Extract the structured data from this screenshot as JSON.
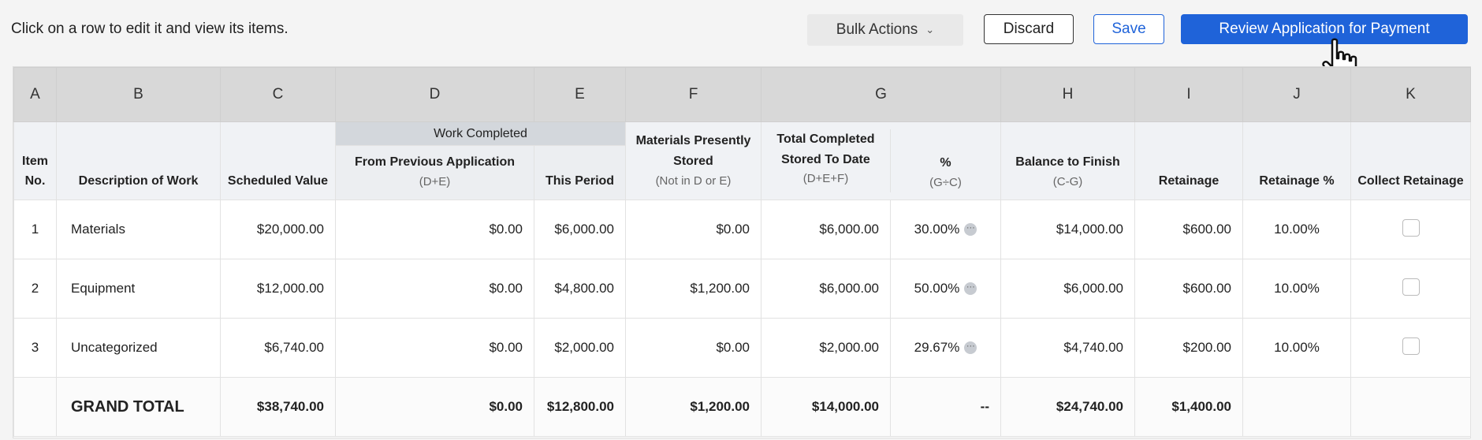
{
  "toolbar": {
    "instructions": "Click on a row to edit it and view its items.",
    "bulk_actions": "Bulk Actions",
    "discard": "Discard",
    "save": "Save",
    "review": "Review Application for Payment"
  },
  "columns": {
    "letters": [
      "A",
      "B",
      "C",
      "D",
      "E",
      "F",
      "G",
      "H",
      "I",
      "J",
      "K"
    ],
    "group_label": "Work Completed",
    "item_no": "Item No.",
    "description": "Description of Work",
    "scheduled": "Scheduled Value",
    "from_prev": "From Previous Application",
    "from_prev_sub": "(D+E)",
    "this_period": "This Period",
    "materials": "Materials Presently Stored",
    "materials_sub": "(Not in D or E)",
    "total_completed": "Total Completed Stored To Date",
    "total_completed_sub": "(D+E+F)",
    "pct": "%",
    "pct_sub": "(G÷C)",
    "balance": "Balance to Finish",
    "balance_sub": "(C-G)",
    "retainage": "Retainage",
    "retainage_pct": "Retainage %",
    "collect": "Collect Retainage"
  },
  "rows": [
    {
      "no": "1",
      "desc": "Materials",
      "scheduled": "$20,000.00",
      "prev": "$0.00",
      "period": "$6,000.00",
      "stored": "$0.00",
      "total": "$6,000.00",
      "pct": "30.00%",
      "balance": "$14,000.00",
      "retainage": "$600.00",
      "ret_pct": "10.00%"
    },
    {
      "no": "2",
      "desc": "Equipment",
      "scheduled": "$12,000.00",
      "prev": "$0.00",
      "period": "$4,800.00",
      "stored": "$1,200.00",
      "total": "$6,000.00",
      "pct": "50.00%",
      "balance": "$6,000.00",
      "retainage": "$600.00",
      "ret_pct": "10.00%"
    },
    {
      "no": "3",
      "desc": "Uncategorized",
      "scheduled": "$6,740.00",
      "prev": "$0.00",
      "period": "$2,000.00",
      "stored": "$0.00",
      "total": "$2,000.00",
      "pct": "29.67%",
      "balance": "$4,740.00",
      "retainage": "$200.00",
      "ret_pct": "10.00%"
    }
  ],
  "grand_total": {
    "label": "GRAND TOTAL",
    "scheduled": "$38,740.00",
    "prev": "$0.00",
    "period": "$12,800.00",
    "stored": "$1,200.00",
    "total": "$14,000.00",
    "pct": "--",
    "balance": "$24,740.00",
    "retainage": "$1,400.00"
  },
  "icons": {
    "more": "ellipsis-icon",
    "dropdown": "chevron-down-icon",
    "cursor": "hand-pointer-icon"
  },
  "colors": {
    "primary": "#1f63d9",
    "header_bg": "#d8d8d8",
    "group_bg": "#d3d7dc"
  }
}
